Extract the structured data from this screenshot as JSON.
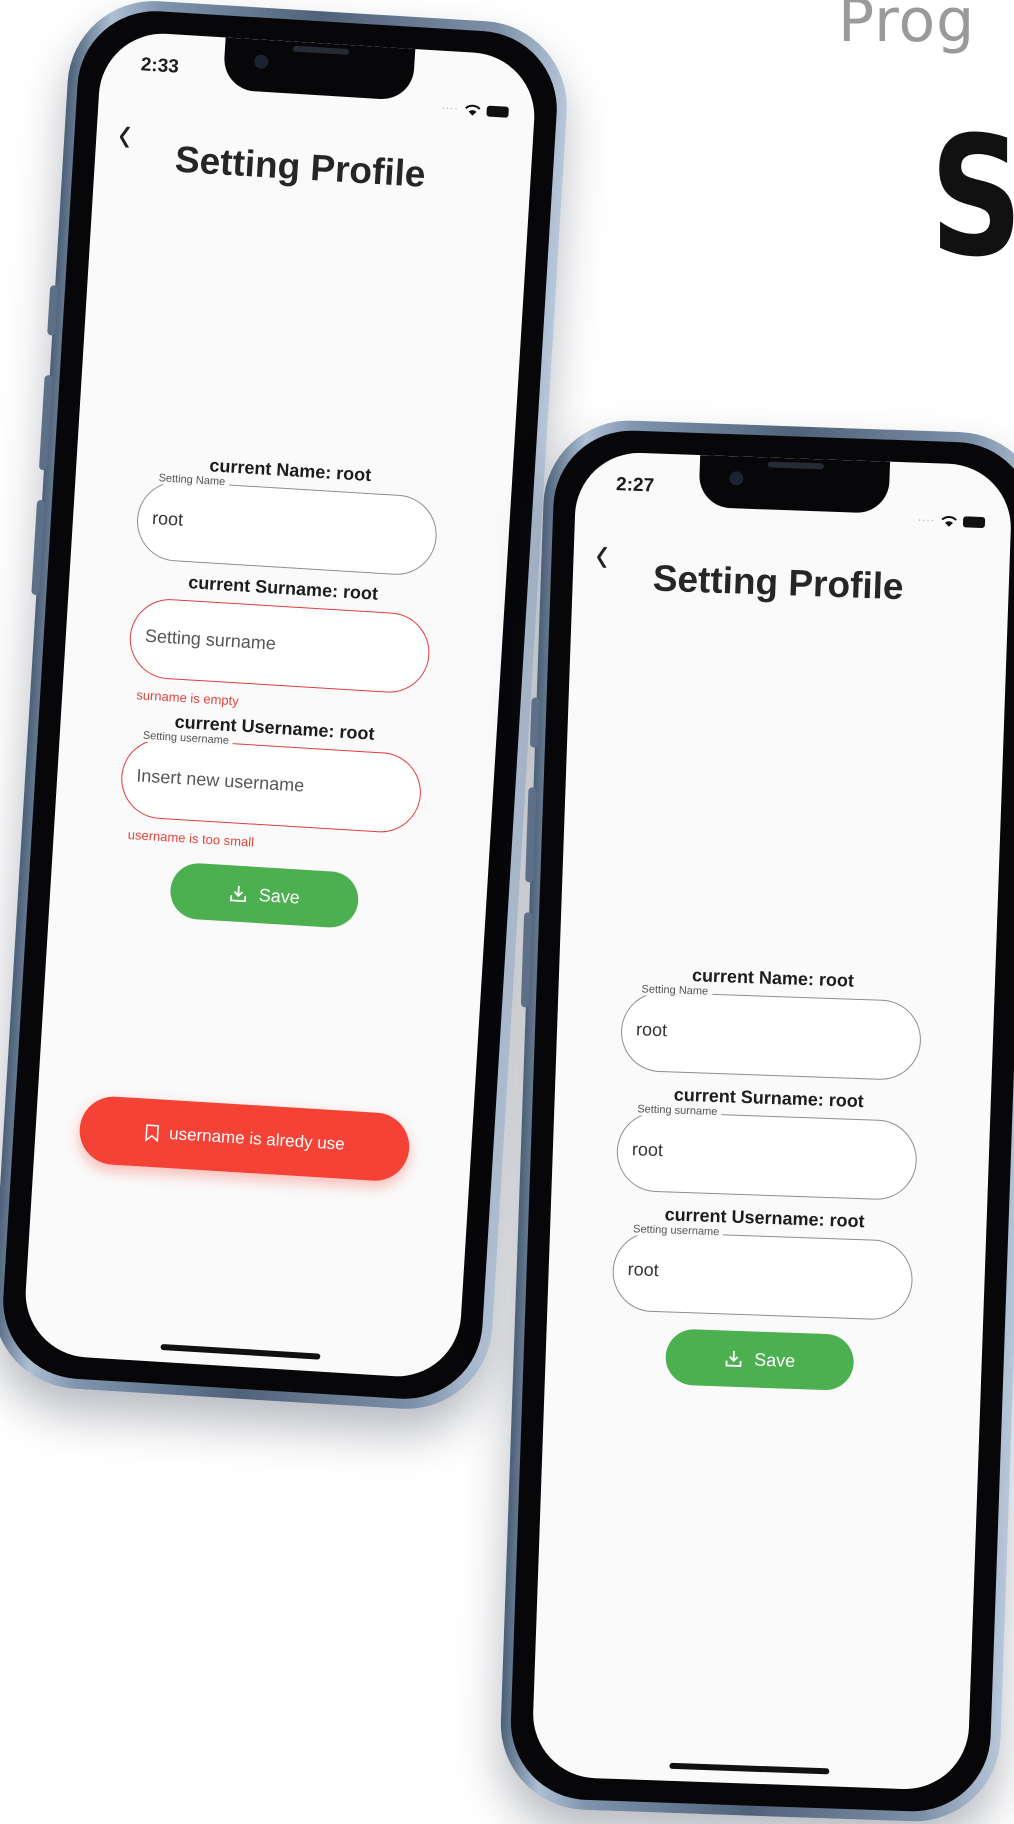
{
  "hero": {
    "line1": "Prog",
    "line2": "S"
  },
  "phone_a": {
    "status_time": "2:33",
    "page_title": "Setting Profile",
    "name_section": {
      "current_label": "current Name: root",
      "legend": "Setting Name",
      "value": "root",
      "placeholder": ""
    },
    "surname_section": {
      "current_label": "current Surname: root",
      "legend": "",
      "value": "",
      "placeholder": "Setting surname",
      "error": "surname is empty"
    },
    "username_section": {
      "current_label": "current Username: root",
      "legend": "Setting username",
      "value": "",
      "placeholder": "Insert new username",
      "error": "username is too small"
    },
    "save_label": "Save",
    "snackbar_text": "username is alredy use"
  },
  "phone_b": {
    "status_time": "2:27",
    "page_title": "Setting Profile",
    "name_section": {
      "current_label": "current Name: root",
      "legend": "Setting Name",
      "value": "root"
    },
    "surname_section": {
      "current_label": "current Surname: root",
      "legend": "Setting surname",
      "value": "root"
    },
    "username_section": {
      "current_label": "current Username: root",
      "legend": "Setting username",
      "value": "root"
    },
    "save_label": "Save"
  },
  "colors": {
    "save_green": "#4caf50",
    "error_red": "#e23d3d",
    "snackbar_red": "#f44336"
  },
  "icons": [
    "back-chevron-icon",
    "wifi-icon",
    "battery-icon",
    "download-icon",
    "bookmark-icon"
  ]
}
